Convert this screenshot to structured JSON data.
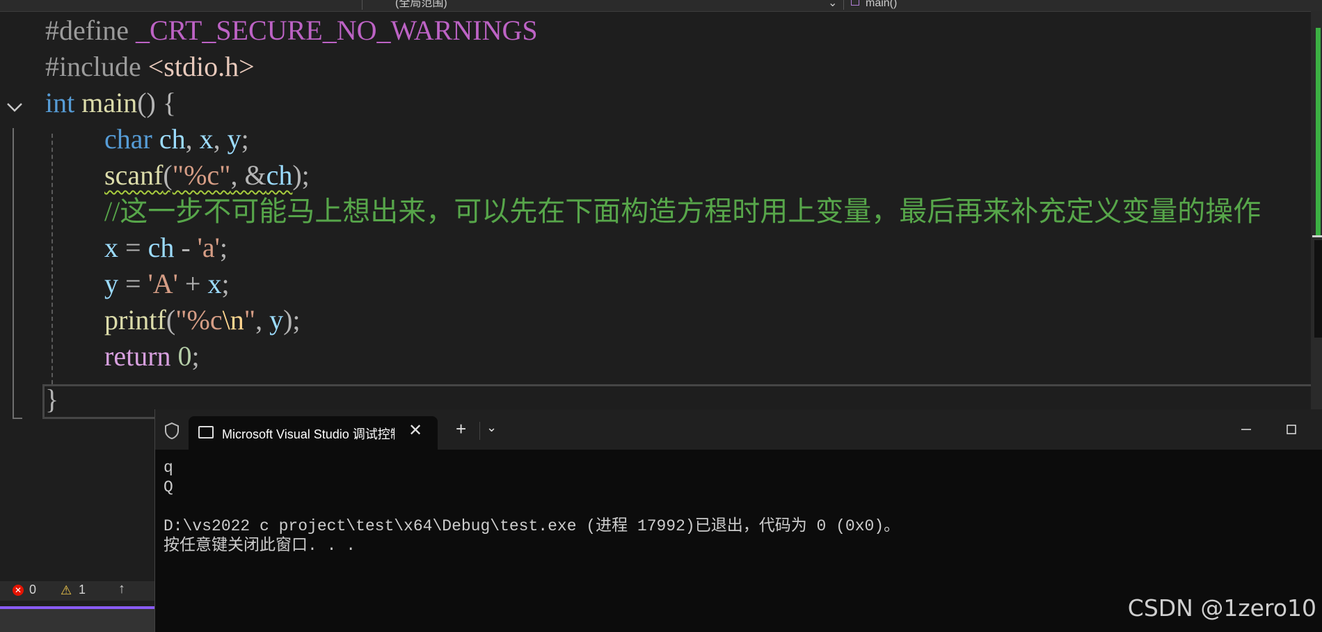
{
  "nav": {
    "scope": "(全局范围)",
    "member": "main()"
  },
  "code": {
    "l1": {
      "dir": "#define",
      "macro": "_CRT_SECURE_NO_WARNINGS"
    },
    "l2": {
      "dir": "#include",
      "file": "<stdio.h>"
    },
    "l3": {
      "kw": "int",
      "fn": "main",
      "rest": "() {"
    },
    "l4": {
      "kw": "char",
      "v1": "ch",
      "c1": ", ",
      "v2": "x",
      "c2": ", ",
      "v3": "y",
      "end": ";"
    },
    "l5": {
      "fn": "scanf",
      "p1": "(",
      "str": "\"%c\"",
      "p2": ", &",
      "v": "ch",
      "end": ");"
    },
    "l6": {
      "comment": "//这一步不可能马上想出来，可以先在下面构造方程时用上变量，最后再来补充定义变量的操作"
    },
    "l7": {
      "v1": "x",
      "op": " = ",
      "v2": "ch",
      "op2": " - ",
      "str": "'a'",
      "end": ";"
    },
    "l8": {
      "v1": "y",
      "op": " = ",
      "str": "'A'",
      "op2": " + ",
      "v2": "x",
      "end": ";"
    },
    "l9": {
      "fn": "printf",
      "p1": "(",
      "str1": "\"%c",
      "esc": "\\n",
      "str2": "\"",
      "p2": ", ",
      "v": "y",
      "end": ");"
    },
    "l10": {
      "kw": "return",
      "num": "0",
      "end": ";"
    },
    "l11": {
      "brace": "}"
    }
  },
  "status": {
    "errors": "0",
    "warnings": "1"
  },
  "terminal": {
    "tab_title": "Microsoft Visual Studio 调试控制台",
    "output": [
      "q",
      "Q",
      "",
      "D:\\vs2022 c project\\test\\x64\\Debug\\test.exe (进程 17992)已退出，代码为 0 (0x0)。",
      "按任意键关闭此窗口. . ."
    ]
  },
  "watermark": "CSDN @1zero10"
}
